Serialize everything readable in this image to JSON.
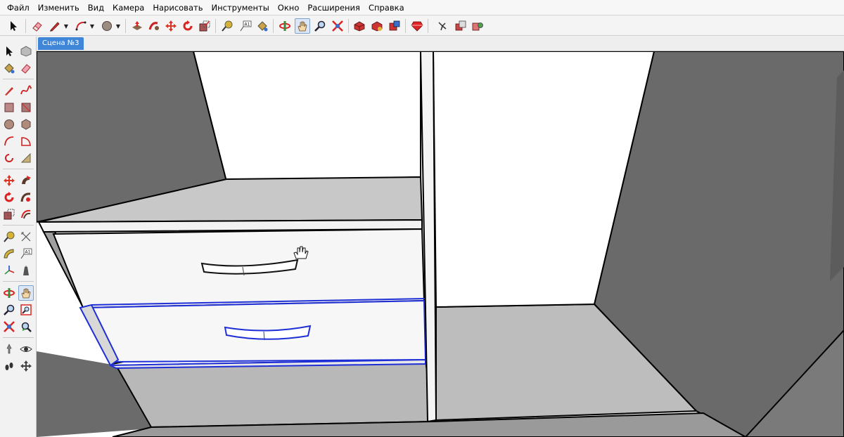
{
  "menu": {
    "items": [
      "Файл",
      "Изменить",
      "Вид",
      "Камера",
      "Нарисовать",
      "Инструменты",
      "Окно",
      "Расширения",
      "Справка"
    ]
  },
  "toolbar": {
    "icons": [
      "select-arrow-icon",
      "eraser-icon",
      "pencil-line-icon",
      "arc-icon",
      "circle-icon",
      "push-pull-icon",
      "follow-me-icon",
      "move-icon",
      "rotate-icon",
      "scale-icon",
      "tape-measure-icon",
      "text-label-icon",
      "paint-bucket-icon",
      "orbit-icon",
      "pan-icon",
      "zoom-icon",
      "zoom-extents-icon",
      "get-models-icon",
      "share-model-icon",
      "extension-warehouse-icon",
      "ruby-console-icon",
      "walk-icon",
      "component-icon",
      "material-icon"
    ],
    "active": "pan-icon"
  },
  "sidebar": {
    "icons": [
      "select-icon",
      "component-icon",
      "paint-bucket-icon",
      "eraser-icon",
      "line-icon",
      "freehand-icon",
      "rectangle-icon",
      "rotated-rectangle-icon",
      "circle-icon",
      "polygon-icon",
      "arc-icon",
      "pie-icon",
      "two-point-arc-icon",
      "three-point-arc-icon",
      "move-icon",
      "push-pull-icon",
      "rotate-icon",
      "follow-me-icon",
      "scale-icon",
      "offset-icon",
      "tape-measure-icon",
      "dimension-icon",
      "protractor-icon",
      "text-icon",
      "axes-icon",
      "3d-text-icon",
      "orbit-icon",
      "pan-icon",
      "zoom-icon",
      "zoom-window-icon",
      "zoom-extents-icon",
      "previous-view-icon",
      "position-camera-icon",
      "look-around-icon",
      "walk-icon",
      "section-plane-icon"
    ],
    "active": "pan-icon"
  },
  "scene": {
    "tab_label": "Сцена №3"
  },
  "colors": {
    "selection": "#1f2fd6",
    "accent": "#3f86d9",
    "side_walls": "#6b6b6b",
    "back_wall": "#ffffff",
    "floor": "#bdbdbd"
  }
}
